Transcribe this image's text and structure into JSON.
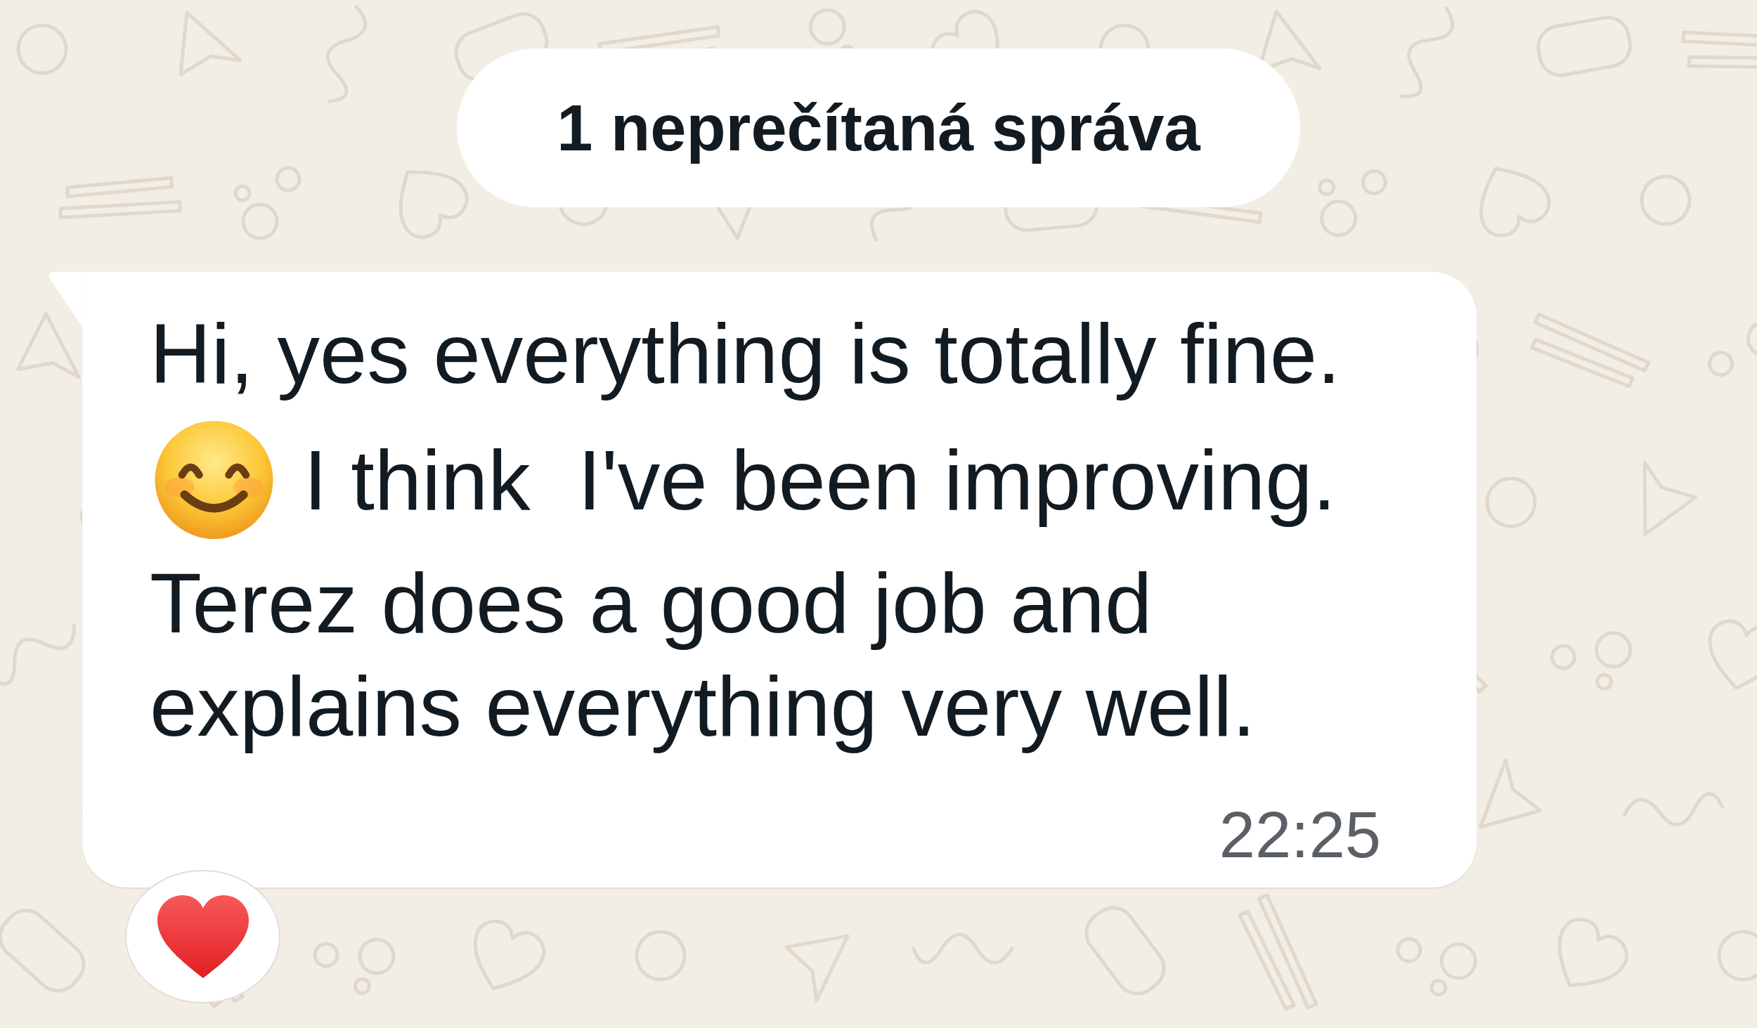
{
  "unread_banner": {
    "label": "1 neprečítaná správa"
  },
  "message": {
    "blocks": [
      {
        "kind": "text",
        "text": "Hi, yes everything is totally fine."
      },
      {
        "kind": "emoji_text",
        "text": "I think  I've been improving."
      },
      {
        "kind": "text",
        "text": "Terez does a good job and explains everything very well."
      }
    ],
    "time": "22:25",
    "reactions": [
      {
        "kind": "heart"
      }
    ]
  }
}
